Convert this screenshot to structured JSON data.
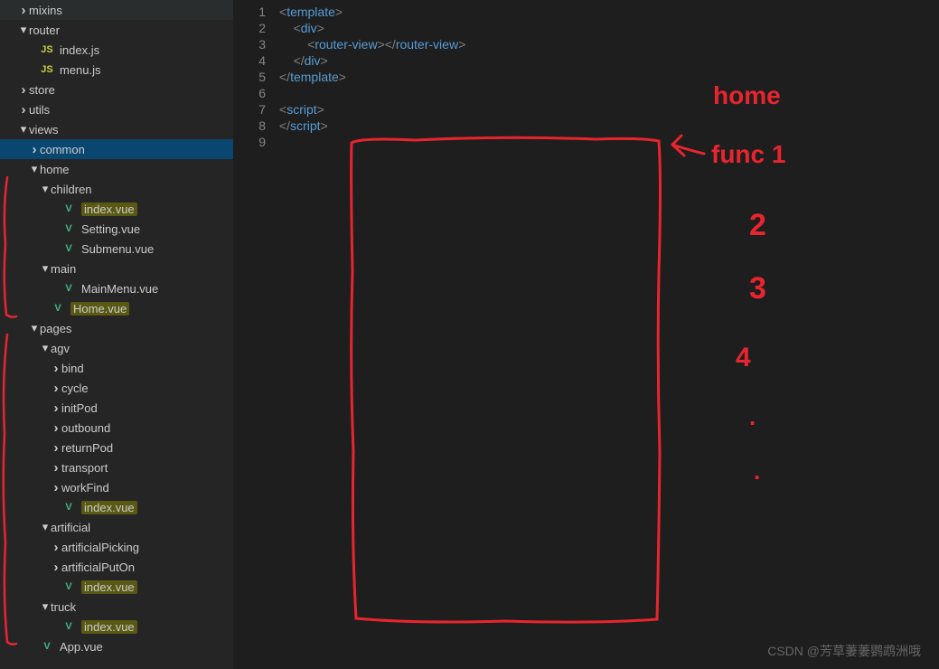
{
  "tree": [
    {
      "depth": 1,
      "chev": "right",
      "icon": null,
      "label": "mixins"
    },
    {
      "depth": 1,
      "chev": "down",
      "icon": null,
      "label": "router"
    },
    {
      "depth": 2,
      "chev": null,
      "icon": "js",
      "label": "index.js"
    },
    {
      "depth": 2,
      "chev": null,
      "icon": "js",
      "label": "menu.js"
    },
    {
      "depth": 1,
      "chev": "right",
      "icon": null,
      "label": "store"
    },
    {
      "depth": 1,
      "chev": "right",
      "icon": null,
      "label": "utils"
    },
    {
      "depth": 1,
      "chev": "down",
      "icon": null,
      "label": "views"
    },
    {
      "depth": 2,
      "chev": "right",
      "icon": null,
      "label": "common",
      "selected": true
    },
    {
      "depth": 2,
      "chev": "down",
      "icon": null,
      "label": "home"
    },
    {
      "depth": 3,
      "chev": "down",
      "icon": null,
      "label": "children"
    },
    {
      "depth": 4,
      "chev": null,
      "icon": "vue",
      "label": "index.vue",
      "highlight": true
    },
    {
      "depth": 4,
      "chev": null,
      "icon": "vue",
      "label": "Setting.vue"
    },
    {
      "depth": 4,
      "chev": null,
      "icon": "vue",
      "label": "Submenu.vue"
    },
    {
      "depth": 3,
      "chev": "down",
      "icon": null,
      "label": "main"
    },
    {
      "depth": 4,
      "chev": null,
      "icon": "vue",
      "label": "MainMenu.vue"
    },
    {
      "depth": 3,
      "chev": null,
      "icon": "vue",
      "label": "Home.vue",
      "highlight": true
    },
    {
      "depth": 2,
      "chev": "down",
      "icon": null,
      "label": "pages"
    },
    {
      "depth": 3,
      "chev": "down",
      "icon": null,
      "label": "agv"
    },
    {
      "depth": 4,
      "chev": "right",
      "icon": null,
      "label": "bind"
    },
    {
      "depth": 4,
      "chev": "right",
      "icon": null,
      "label": "cycle"
    },
    {
      "depth": 4,
      "chev": "right",
      "icon": null,
      "label": "initPod"
    },
    {
      "depth": 4,
      "chev": "right",
      "icon": null,
      "label": "outbound"
    },
    {
      "depth": 4,
      "chev": "right",
      "icon": null,
      "label": "returnPod"
    },
    {
      "depth": 4,
      "chev": "right",
      "icon": null,
      "label": "transport"
    },
    {
      "depth": 4,
      "chev": "right",
      "icon": null,
      "label": "workFind"
    },
    {
      "depth": 4,
      "chev": null,
      "icon": "vue",
      "label": "index.vue",
      "highlight": true
    },
    {
      "depth": 3,
      "chev": "down",
      "icon": null,
      "label": "artificial"
    },
    {
      "depth": 4,
      "chev": "right",
      "icon": null,
      "label": "artificialPicking"
    },
    {
      "depth": 4,
      "chev": "right",
      "icon": null,
      "label": "artificialPutOn"
    },
    {
      "depth": 4,
      "chev": null,
      "icon": "vue",
      "label": "index.vue",
      "highlight": true
    },
    {
      "depth": 3,
      "chev": "down",
      "icon": null,
      "label": "truck"
    },
    {
      "depth": 4,
      "chev": null,
      "icon": "vue",
      "label": "index.vue",
      "highlight": true
    },
    {
      "depth": 2,
      "chev": null,
      "icon": "vue",
      "label": "App.vue"
    }
  ],
  "code": {
    "lines": [
      {
        "n": 1,
        "indent": 0,
        "open": true,
        "tag": "template",
        "close": false
      },
      {
        "n": 2,
        "indent": 1,
        "open": true,
        "tag": "div",
        "close": false
      },
      {
        "n": 3,
        "indent": 2,
        "open": true,
        "tag": "router-view",
        "close": true,
        "closeTag": "router-view"
      },
      {
        "n": 4,
        "indent": 1,
        "open": false,
        "tag": "div",
        "close": true
      },
      {
        "n": 5,
        "indent": 0,
        "open": false,
        "tag": "template",
        "close": true
      },
      {
        "n": 6,
        "indent": 0,
        "blank": true
      },
      {
        "n": 7,
        "indent": 0,
        "open": true,
        "tag": "script",
        "close": false
      },
      {
        "n": 8,
        "indent": 0,
        "open": false,
        "tag": "script",
        "close": true
      },
      {
        "n": 9,
        "indent": 0,
        "blank": true
      }
    ]
  },
  "annotations": {
    "labels": [
      "home",
      "func 1",
      "2",
      "3",
      "4",
      ".",
      "."
    ],
    "color": "#e8252f"
  },
  "watermark": "CSDN @芳草萋萋鹦鹉洲哦"
}
